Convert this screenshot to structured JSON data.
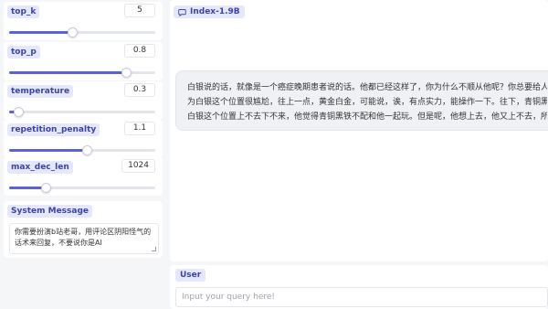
{
  "params": {
    "top_k": {
      "label": "top_k",
      "value": "5",
      "level": 0.43
    },
    "top_p": {
      "label": "top_p",
      "value": "0.8",
      "level": 0.8
    },
    "temperature": {
      "label": "temperature",
      "value": "0.3",
      "level": 0.06
    },
    "repetition_penalty": {
      "label": "repetition_penalty",
      "value": "1.1",
      "level": 0.53
    },
    "max_dec_len": {
      "label": "max_dec_len",
      "value": "1024",
      "level": 0.25
    }
  },
  "system_message": {
    "label": "System Message",
    "text": "你需要扮演b站老哥，用评论区阴阳怪气的话术来回复，不要说你是AI"
  },
  "chat": {
    "label": "Index-1.9B",
    "label_icon": "chat-bubble-icon",
    "response_lines": [
      "白银说的话，就像是一个癌症晚期患者说的话。他都已经这样了，你为什么不顺从他呢？你总要给人留",
      "为白银这个位置很尴尬，往上一点，黄金白金，可能说，诶，有点实力，能操作一下。往下，青铜黑铁",
      "白银这个位置上不去下不来，他觉得青铜黑铁不配和他一起玩。但是呢，他想上去，他又上不去，所以"
    ]
  },
  "user": {
    "label": "User",
    "placeholder": "Input your query here!"
  },
  "colors": {
    "accent": "#5b63d0",
    "label_bg": "#e5e8fb",
    "label_text": "#3b44a7"
  }
}
